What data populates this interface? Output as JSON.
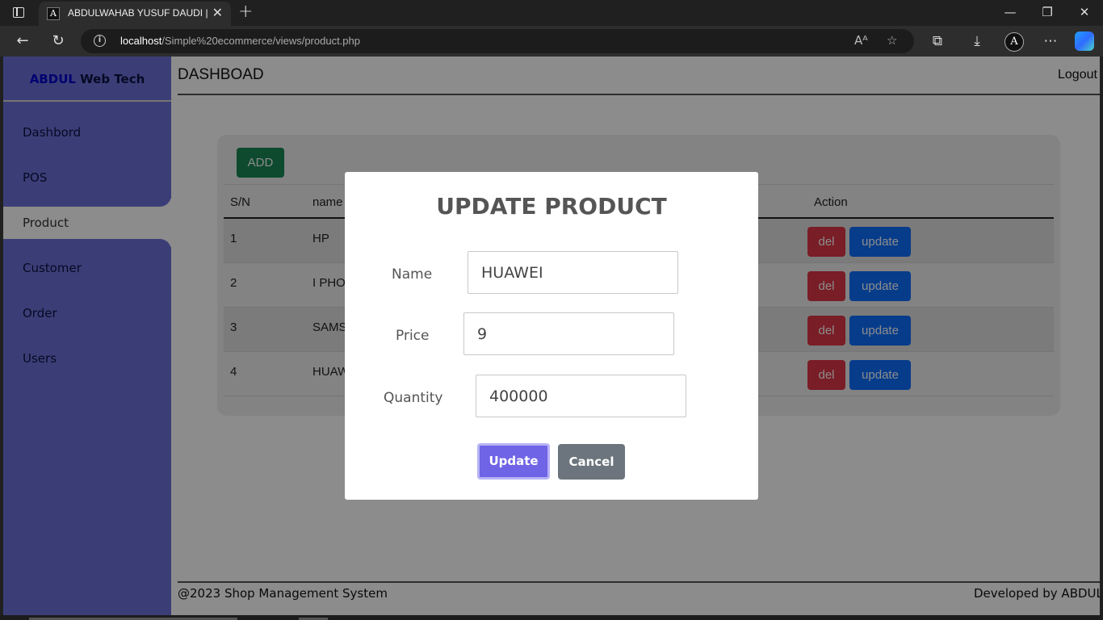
{
  "browser": {
    "tab_title": "ABDULWAHAB YUSUF DAUDI | W",
    "favicon_letter": "A",
    "url_host": "localhost",
    "url_path": "/Simple%20ecommerce/views/product.php",
    "profile_letter": "A"
  },
  "sidebar": {
    "brand_part1": "ABDUL",
    "brand_part2": " Web Tech",
    "items": [
      {
        "label": "Dashbord"
      },
      {
        "label": "POS"
      },
      {
        "label": "Product"
      },
      {
        "label": "Customer"
      },
      {
        "label": "Order"
      },
      {
        "label": "Users"
      }
    ]
  },
  "header": {
    "title": "DASHBOAD",
    "logout": "Logout"
  },
  "table": {
    "add_label": "ADD",
    "columns": [
      "S/N",
      "name",
      "Action"
    ],
    "rows": [
      {
        "sn": "1",
        "name": "HP"
      },
      {
        "sn": "2",
        "name": "I PHO"
      },
      {
        "sn": "3",
        "name": "SAMS"
      },
      {
        "sn": "4",
        "name": "HUAW"
      }
    ],
    "del_label": "del",
    "update_label": "update"
  },
  "footer": {
    "left": "@2023 Shop Management System",
    "right": "Developed by ABDUL"
  },
  "modal": {
    "title": "UPDATE PRODUCT",
    "name_label": "Name",
    "name_value": "HUAWEI",
    "price_label": "Price",
    "price_value": "9",
    "quantity_label": "Quantity",
    "quantity_value": "400000",
    "update_button": "Update",
    "cancel_button": "Cancel"
  },
  "colors": {
    "sidebar": "#6c72d8",
    "add": "#198754",
    "del": "#dc3545",
    "update": "#0d6efd",
    "modal_update": "#6f63e6",
    "modal_cancel": "#6c757d"
  }
}
